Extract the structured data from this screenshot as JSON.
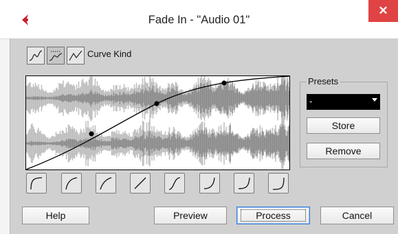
{
  "window": {
    "title": "Fade In - \"Audio 01\"",
    "close_label": "✕",
    "logo_icon": "cubase-logo-icon",
    "accent_color": "#c8202c",
    "close_color": "#e04343"
  },
  "curve_kind": {
    "label": "Curve Kind",
    "options": [
      {
        "icon": "spline-curve-icon",
        "selected": false
      },
      {
        "icon": "damped-spline-curve-icon",
        "selected": true
      },
      {
        "icon": "linear-curve-icon",
        "selected": false
      }
    ]
  },
  "fade_display": {
    "waveform_color": "#8a8a8a",
    "original_waveform_color": "#bdbdbd",
    "curve_color": "#000000"
  },
  "presets": {
    "group_label": "Presets",
    "selected_value": "-",
    "store_label": "Store",
    "remove_label": "Remove"
  },
  "curve_shapes": [
    "quarter-circle-curve-icon",
    "slow-start-curve-icon",
    "soft-curve-icon",
    "linear-shape-icon",
    "s-curve-icon",
    "fast-end-curve-icon",
    "steep-end-curve-icon",
    "late-curve-icon"
  ],
  "footer": {
    "help_label": "Help",
    "preview_label": "Preview",
    "process_label": "Process",
    "cancel_label": "Cancel"
  }
}
